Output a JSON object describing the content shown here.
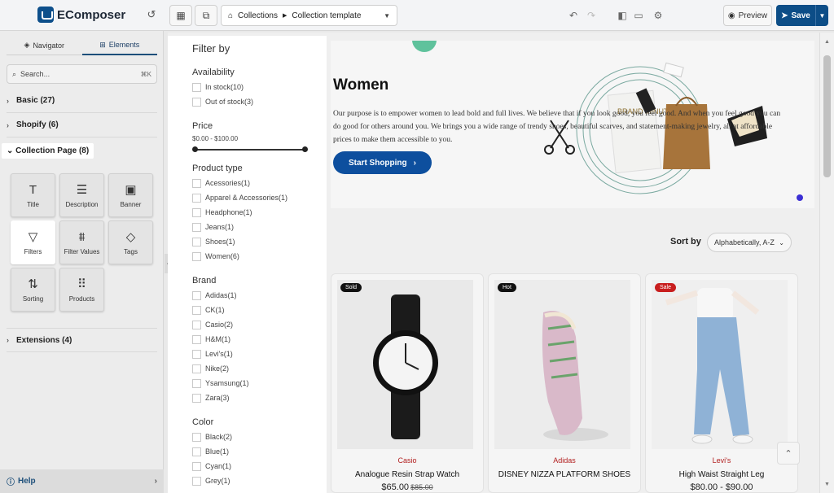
{
  "app": {
    "name": "EComposer"
  },
  "toolbar": {
    "breadcrumb_root": "Collections",
    "breadcrumb_leaf": "Collection template",
    "preview_label": "Preview",
    "save_label": "Save"
  },
  "sidebar": {
    "tabs": [
      {
        "label": "Navigator"
      },
      {
        "label": "Elements"
      }
    ],
    "search": {
      "placeholder": "Search...",
      "shortcut": "⌘K"
    },
    "groups": {
      "basic": "Basic (27)",
      "shopify": "Shopify (6)",
      "collection_page": "Collection Page (8)",
      "extensions": "Extensions (4)"
    },
    "tiles": [
      {
        "label": "Title",
        "icon": "title-icon"
      },
      {
        "label": "Description",
        "icon": "description-icon"
      },
      {
        "label": "Banner",
        "icon": "image-icon"
      },
      {
        "label": "Filters",
        "icon": "filter-icon"
      },
      {
        "label": "Filter Values",
        "icon": "filter-values-icon"
      },
      {
        "label": "Tags",
        "icon": "tag-icon"
      },
      {
        "label": "Sorting",
        "icon": "sort-icon"
      },
      {
        "label": "Products",
        "icon": "grid-icon"
      }
    ],
    "help": "Help"
  },
  "filter": {
    "title": "Filter by",
    "availability": {
      "heading": "Availability",
      "items": [
        "In stock(10)",
        "Out of stock(3)"
      ]
    },
    "price": {
      "heading": "Price",
      "range": "$0.00 - $100.00"
    },
    "product_type": {
      "heading": "Product type",
      "items": [
        "Acessories(1)",
        "Apparel & Accessories(1)",
        "Headphone(1)",
        "Jeans(1)",
        "Shoes(1)",
        "Women(6)"
      ]
    },
    "brand": {
      "heading": "Brand",
      "items": [
        "Adidas(1)",
        "CK(1)",
        "Casio(2)",
        "H&M(1)",
        "Levi's(1)",
        "Nike(2)",
        "Ysamsung(1)",
        "Zara(3)"
      ]
    },
    "color": {
      "heading": "Color",
      "items": [
        "Black(2)",
        "Blue(1)",
        "Cyan(1)",
        "Grey(1)"
      ]
    }
  },
  "hero": {
    "title": "Women",
    "text": "Our purpose is to empower women to lead bold and full lives. We believe that if you look good, you feel good. And when you feel good you can do good for others around you. We brings you a wide range of trendy shoes, beautiful scarves, and statement-making jewelry, all at affordable prices to make them accessible to you.",
    "button": "Start Shopping",
    "bag_text": "BRAND MINUTE"
  },
  "sort": {
    "label": "Sort by",
    "selected": "Alphabetically, A-Z"
  },
  "products": [
    {
      "badge": "Sold",
      "badge_color": "#111111",
      "brand": "Casio",
      "name": "Analogue Resin Strap Watch",
      "price": "$65.00",
      "compare": "$85.00"
    },
    {
      "badge": "Hot",
      "badge_color": "#111111",
      "brand": "Adidas",
      "name": "DISNEY NIZZA PLATFORM SHOES",
      "price": "",
      "compare": ""
    },
    {
      "badge": "Sale",
      "badge_color": "#c81e1e",
      "brand": "Levi's",
      "name": "High Waist Straight Leg",
      "price": "$80.00   - $90.00",
      "compare": ""
    }
  ],
  "colors": {
    "brand": "#0c4d87",
    "accent": "#0d4f9e",
    "sale": "#c81e1e"
  }
}
